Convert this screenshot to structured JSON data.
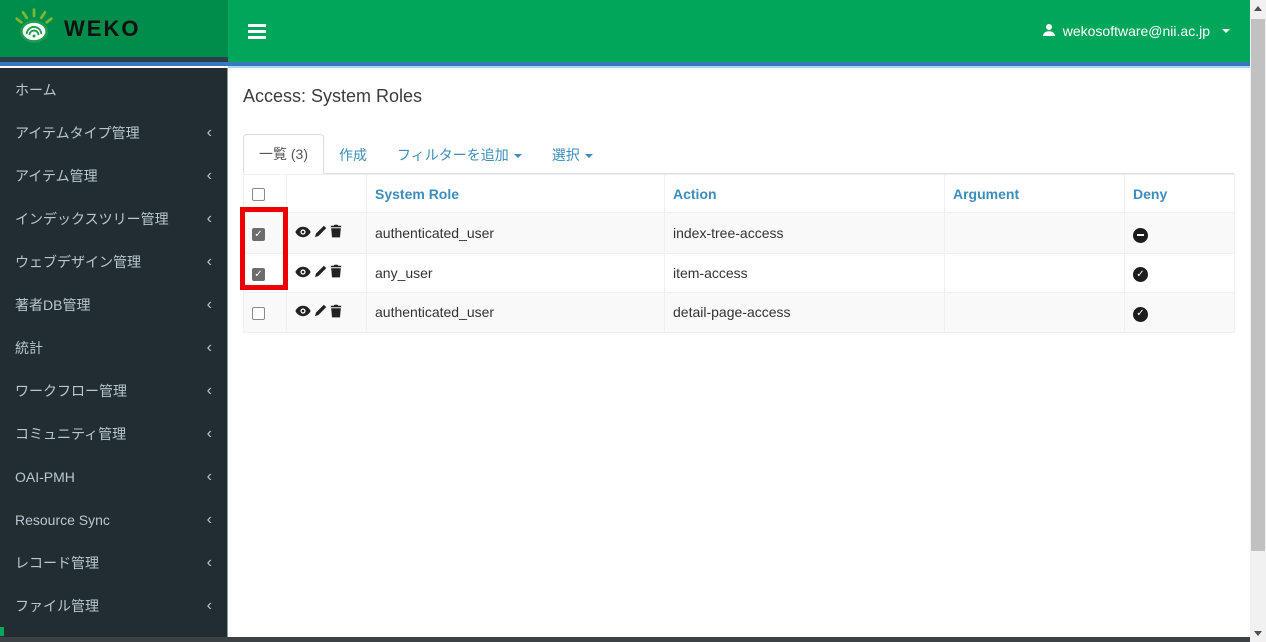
{
  "header": {
    "logo_text": "WEKO",
    "user": {
      "email": "wekosoftware@nii.ac.jp"
    }
  },
  "sidebar": {
    "items": [
      {
        "key": "home",
        "label": "ホーム",
        "expandable": false
      },
      {
        "key": "item-type-mgmt",
        "label": "アイテムタイプ管理",
        "expandable": true
      },
      {
        "key": "item-mgmt",
        "label": "アイテム管理",
        "expandable": true
      },
      {
        "key": "index-tree-mgmt",
        "label": "インデックスツリー管理",
        "expandable": true
      },
      {
        "key": "web-design-mgmt",
        "label": "ウェブデザイン管理",
        "expandable": true
      },
      {
        "key": "author-db-mgmt",
        "label": "著者DB管理",
        "expandable": true
      },
      {
        "key": "statistics",
        "label": "統計",
        "expandable": true
      },
      {
        "key": "workflow-mgmt",
        "label": "ワークフロー管理",
        "expandable": true
      },
      {
        "key": "community-mgmt",
        "label": "コミュニティ管理",
        "expandable": true
      },
      {
        "key": "oai-pmh",
        "label": "OAI-PMH",
        "expandable": true
      },
      {
        "key": "resource-sync",
        "label": "Resource Sync",
        "expandable": true
      },
      {
        "key": "record-mgmt",
        "label": "レコード管理",
        "expandable": true
      },
      {
        "key": "file-mgmt",
        "label": "ファイル管理",
        "expandable": true
      }
    ]
  },
  "main": {
    "title": "Access: System Roles",
    "tabs": [
      {
        "key": "list",
        "label": "一覧 (3)",
        "active": true,
        "dropdown": false
      },
      {
        "key": "create",
        "label": "作成",
        "active": false,
        "dropdown": false
      },
      {
        "key": "add-filter",
        "label": "フィルターを追加",
        "active": false,
        "dropdown": true
      },
      {
        "key": "select",
        "label": "選択",
        "active": false,
        "dropdown": true
      }
    ],
    "table": {
      "columns": [
        "System Role",
        "Action",
        "Argument",
        "Deny"
      ],
      "rows": [
        {
          "checked": true,
          "system_role": "authenticated_user",
          "action": "index-tree-access",
          "argument": "",
          "deny": "deny"
        },
        {
          "checked": true,
          "system_role": "any_user",
          "action": "item-access",
          "argument": "",
          "deny": "allow"
        },
        {
          "checked": false,
          "system_role": "authenticated_user",
          "action": "detail-page-access",
          "argument": "",
          "deny": "allow"
        }
      ]
    }
  },
  "annotation": {
    "shape": "rectangle",
    "color": "#ee0000",
    "target": "checkboxes-rows-1-2"
  },
  "colors": {
    "navbar_green": "#00a65a",
    "logo_green": "#008d4c",
    "accent_blue_line": "#3779bd",
    "link_blue": "#3c8dbc",
    "sidebar_bg": "#222d32",
    "sidebar_text": "#b8c7ce",
    "row_stripe": "#f9f9f9",
    "deny_icon": "#1d1d1d",
    "annotation_red": "#ee0000"
  }
}
